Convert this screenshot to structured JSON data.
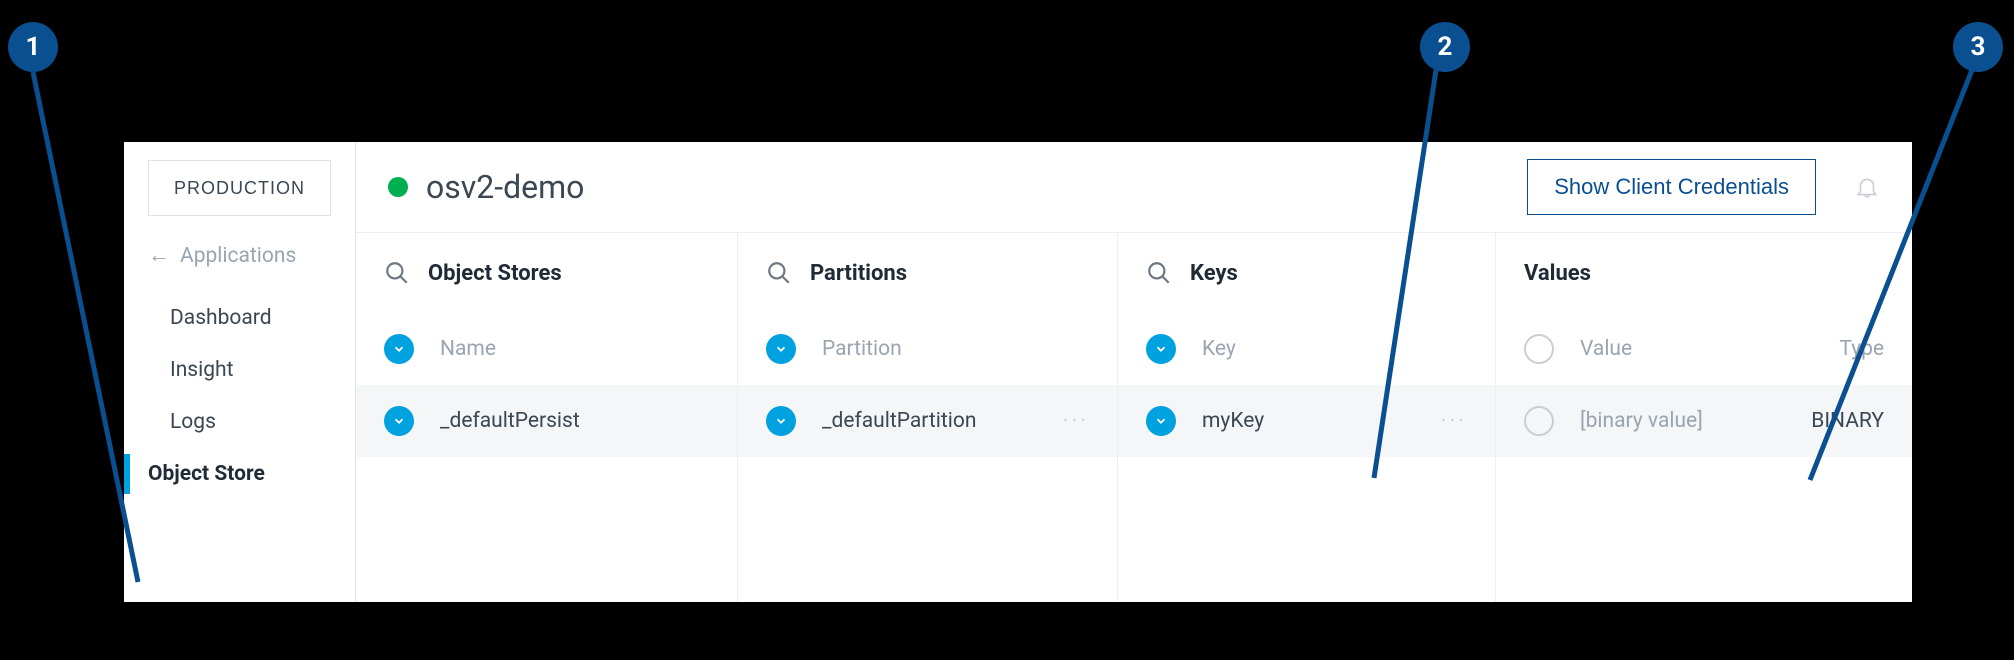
{
  "callouts": {
    "c1": "1",
    "c2": "2",
    "c3": "3"
  },
  "sidebar": {
    "env_label": "PRODUCTION",
    "back_label": "Applications",
    "links": {
      "dashboard": "Dashboard",
      "insight": "Insight",
      "logs": "Logs",
      "object_store": "Object Store"
    }
  },
  "header": {
    "title": "osv2-demo",
    "credentials_label": "Show Client Credentials"
  },
  "columns": {
    "object_stores": {
      "title": "Object Stores",
      "sub": "Name",
      "row": "_defaultPersist"
    },
    "partitions": {
      "title": "Partitions",
      "sub": "Partition",
      "row": "_defaultPartition"
    },
    "keys": {
      "title": "Keys",
      "sub": "Key",
      "row": "myKey"
    },
    "values": {
      "title": "Values",
      "sub_value": "Value",
      "sub_type": "Type",
      "row_value": "[binary value]",
      "row_type": "BINARY"
    }
  }
}
